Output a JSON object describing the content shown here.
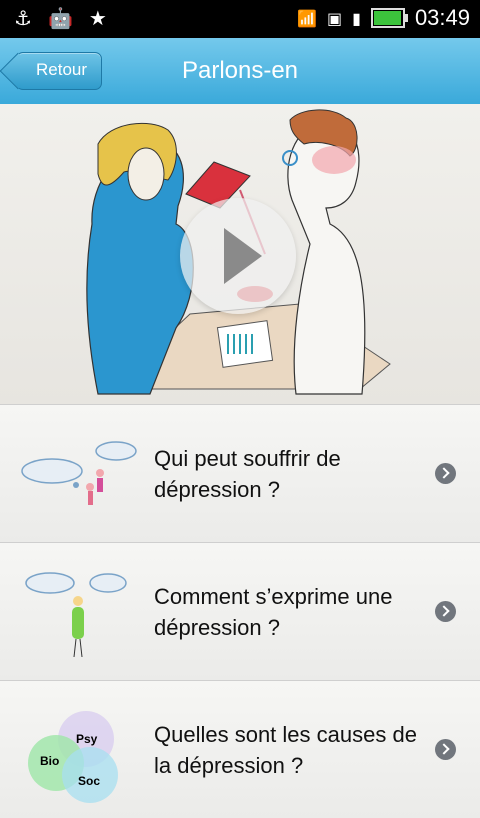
{
  "statusbar": {
    "time": "03:49",
    "icons": [
      "usb-icon",
      "android-icon",
      "star-icon",
      "wifi-icon",
      "sd-icon",
      "signal-icon",
      "battery-icon"
    ]
  },
  "header": {
    "back_label": "Retour",
    "title": "Parlons-en"
  },
  "video": {
    "play_icon": "play-icon"
  },
  "list": {
    "items": [
      {
        "label": "Qui peut souffrir de dépression ?"
      },
      {
        "label": "Comment s’exprime une dépression ?"
      },
      {
        "label": "Quelles sont les causes de la dépression ?",
        "venn_labels": [
          "Psy",
          "Bio",
          "Soc"
        ]
      }
    ]
  },
  "colors": {
    "header_blue": "#3aa9da",
    "battery_green": "#3cc43c"
  }
}
